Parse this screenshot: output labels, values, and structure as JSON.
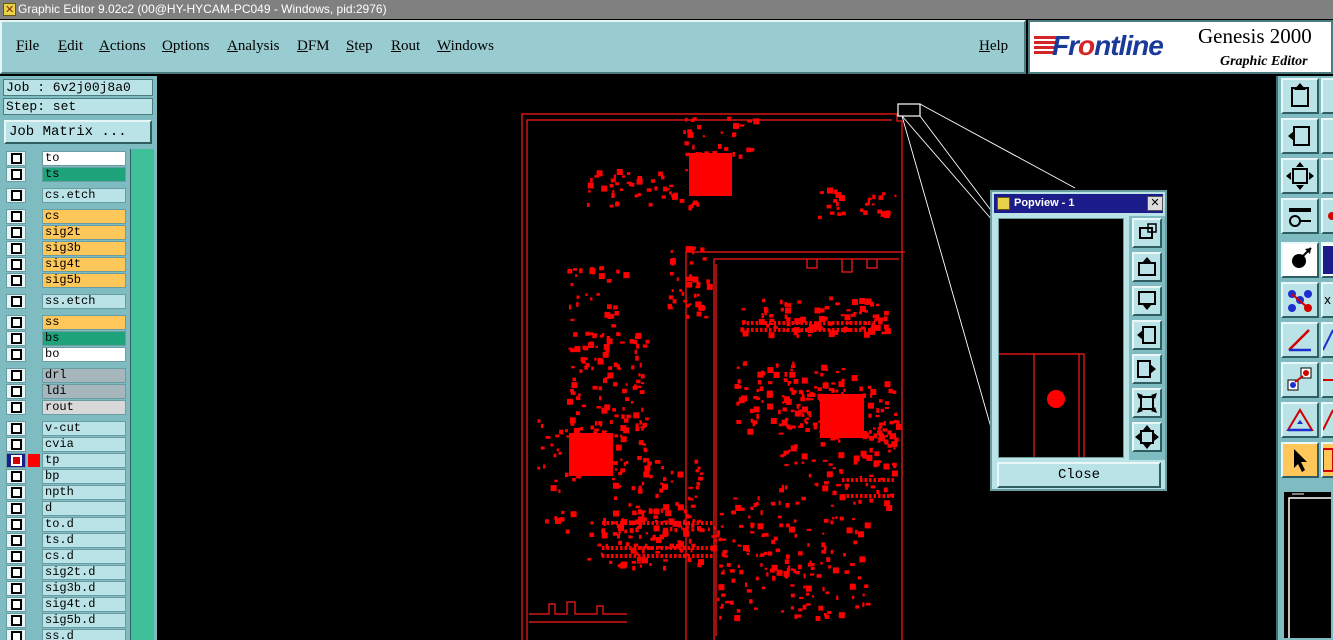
{
  "window": {
    "title": "Graphic Editor 9.02c2 (00@HY-HYCAM-PC049 - Windows, pid:2976)"
  },
  "menu": {
    "items": [
      "File",
      "Edit",
      "Actions",
      "Options",
      "Analysis",
      "DFM",
      "Step",
      "Rout",
      "Windows"
    ],
    "help": "Help"
  },
  "brand": {
    "frontline_a": "Fr",
    "frontline_o": "o",
    "frontline_b": "ntline",
    "product": "Genesis 2000",
    "subtitle": "Graphic Editor"
  },
  "left_panel": {
    "job": "Job : 6v2j00j8a0",
    "step": "Step: set",
    "job_matrix": "Job Matrix ...",
    "layers": [
      {
        "name": "to",
        "color": "#ffffff"
      },
      {
        "name": "ts",
        "color": "#1fa37a"
      },
      {
        "name": "cs.etch",
        "color": "#b9e3e6"
      },
      {
        "name": "cs",
        "color": "#ffc75a"
      },
      {
        "name": "sig2t",
        "color": "#ffc75a"
      },
      {
        "name": "sig3b",
        "color": "#ffc75a"
      },
      {
        "name": "sig4t",
        "color": "#ffc75a"
      },
      {
        "name": "sig5b",
        "color": "#ffc75a"
      },
      {
        "name": "ss.etch",
        "color": "#b9e3e6"
      },
      {
        "name": "ss",
        "color": "#ffc75a"
      },
      {
        "name": "bs",
        "color": "#1fa37a"
      },
      {
        "name": "bo",
        "color": "#ffffff"
      },
      {
        "name": "drl",
        "color": "#a7b5bd"
      },
      {
        "name": "ldi",
        "color": "#a7b5bd"
      },
      {
        "name": "rout",
        "color": "#d8d8d8"
      },
      {
        "name": "v-cut",
        "color": "#b9e3e6"
      },
      {
        "name": "cvia",
        "color": "#b9e3e6"
      },
      {
        "name": "tp",
        "color": "#b9e3e6",
        "active": true
      },
      {
        "name": "bp",
        "color": "#b9e3e6"
      },
      {
        "name": "npth",
        "color": "#b9e3e6"
      },
      {
        "name": "d",
        "color": "#b9e3e6"
      },
      {
        "name": "to.d",
        "color": "#b9e3e6"
      },
      {
        "name": "ts.d",
        "color": "#b9e3e6"
      },
      {
        "name": "cs.d",
        "color": "#b9e3e6"
      },
      {
        "name": "sig2t.d",
        "color": "#b9e3e6"
      },
      {
        "name": "sig3b.d",
        "color": "#b9e3e6"
      },
      {
        "name": "sig4t.d",
        "color": "#b9e3e6"
      },
      {
        "name": "sig5b.d",
        "color": "#b9e3e6"
      },
      {
        "name": "ss.d",
        "color": "#b9e3e6"
      }
    ]
  },
  "popview": {
    "title": "Popview - 1",
    "close_label": "Close"
  },
  "colors": {
    "panel": "#7fbcc2",
    "button": "#b9e3e6",
    "artwork": "#ff0000"
  }
}
